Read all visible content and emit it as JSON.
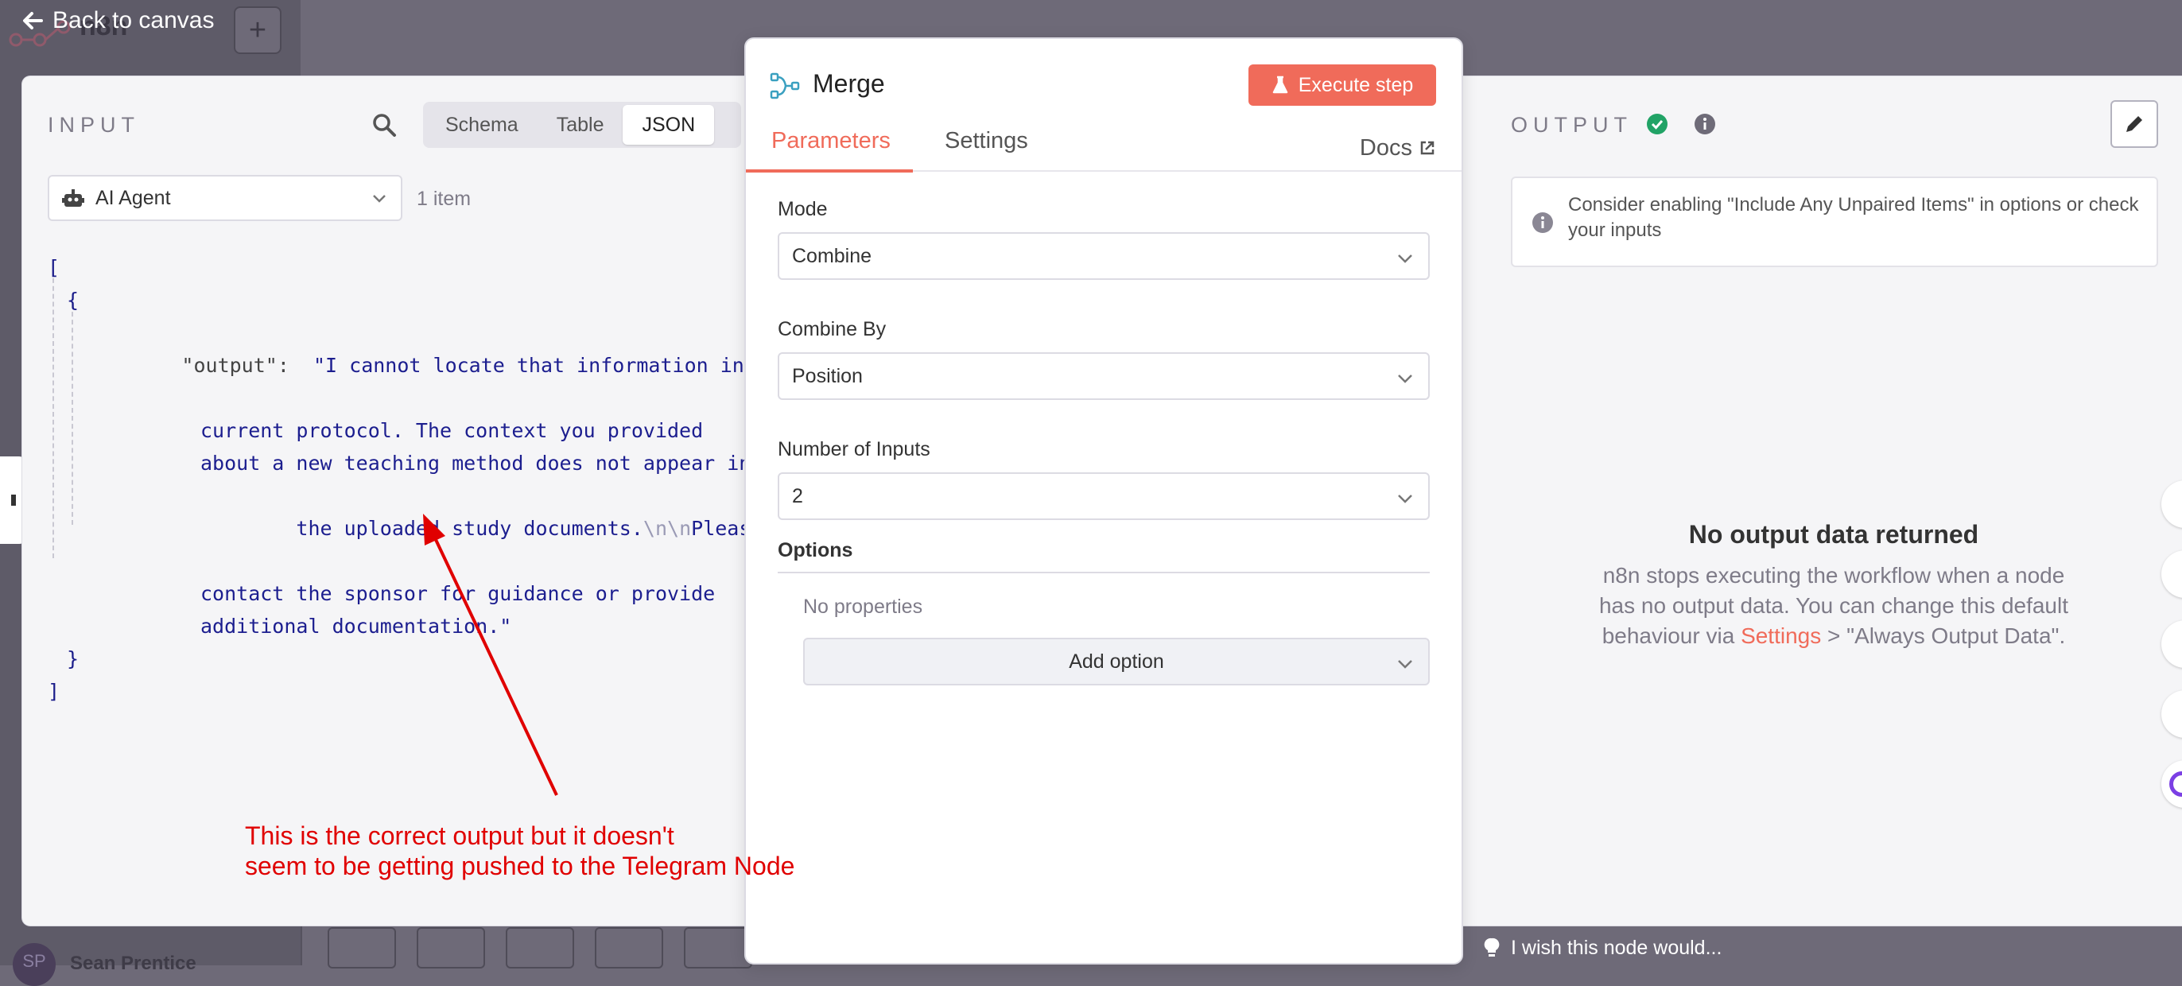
{
  "background": {
    "back_to_canvas": "Back to canvas",
    "app_name_partial": "n8n",
    "bottom_user_initials": "SP",
    "bottom_user_name": "Sean Prentice"
  },
  "input": {
    "title": "INPUT",
    "views": [
      "Schema",
      "Table",
      "JSON"
    ],
    "active_view": "JSON",
    "node_selector": "AI Agent",
    "item_count": "1 item",
    "json": {
      "open_bracket": "[",
      "open_brace": "{",
      "key": "\"output\":",
      "value_lines": [
        "\"I cannot locate that information in the",
        "current protocol. The context you provided",
        "about a new teaching method does not appear in",
        "the uploaded study documents.",
        "contact the sponsor for guidance or provide",
        "additional documentation.\""
      ],
      "escape_seq": "\\n\\n",
      "after_escape": "Please",
      "close_brace": "}",
      "close_bracket": "]"
    }
  },
  "merge": {
    "title": "Merge",
    "execute_label": "Execute step",
    "tabs": {
      "parameters": "Parameters",
      "settings": "Settings",
      "docs": "Docs"
    },
    "active_tab": "Parameters",
    "fields": [
      {
        "label": "Mode",
        "value": "Combine"
      },
      {
        "label": "Combine By",
        "value": "Position"
      },
      {
        "label": "Number of Inputs",
        "value": "2"
      }
    ],
    "options_label": "Options",
    "no_properties": "No properties",
    "add_option": "Add option"
  },
  "output": {
    "title": "OUTPUT",
    "hint": "Consider enabling \"Include Any Unpaired Items\" in options or check your inputs",
    "empty_title": "No output data returned",
    "empty_line1": "n8n stops executing the workflow when a node",
    "empty_line2": "has no output data. You can change this default",
    "empty_line3_pre": "behaviour via",
    "empty_link": "Settings",
    "empty_line3_post": "> \"Always Output Data\"."
  },
  "annotation": {
    "line1": "This is the correct output but it doesn't",
    "line2": "seem to be getting pushed to the Telegram Node",
    "color": "#e00000"
  },
  "feedback": "I wish this node would...",
  "colors": {
    "accent": "#f06b5a",
    "success": "#21a366",
    "annotation": "#e00000"
  }
}
